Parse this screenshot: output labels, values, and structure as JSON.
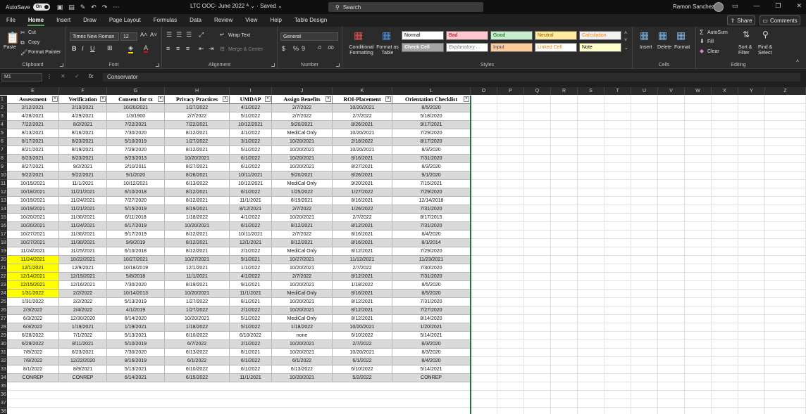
{
  "titlebar": {
    "autosave_label": "AutoSave",
    "autosave_state": "On",
    "doc_title": "LTC OOC- June 2022",
    "saved": "Saved",
    "search_placeholder": "Search",
    "user_name": "Ramon Sanchez"
  },
  "menu": [
    "File",
    "Home",
    "Insert",
    "Draw",
    "Page Layout",
    "Formulas",
    "Data",
    "Review",
    "View",
    "Help",
    "Table Design"
  ],
  "share_label": "Share",
  "comments_label": "Comments",
  "ribbon": {
    "clipboard": {
      "paste": "Paste",
      "cut": "Cut",
      "copy": "Copy",
      "format_painter": "Format Painter",
      "label": "Clipboard"
    },
    "font": {
      "name": "Times New Roman",
      "size": "12",
      "label": "Font"
    },
    "alignment": {
      "wrap": "Wrap Text",
      "merge": "Merge & Center",
      "label": "Alignment"
    },
    "number": {
      "format": "General",
      "label": "Number"
    },
    "styles": {
      "conditional": "Conditional Formatting",
      "format_table": "Format as Table",
      "cells": [
        {
          "text": "Normal",
          "bg": "#ffffff",
          "fg": "#000000"
        },
        {
          "text": "Bad",
          "bg": "#ffc7ce",
          "fg": "#9c0006"
        },
        {
          "text": "Good",
          "bg": "#c6efce",
          "fg": "#006100"
        },
        {
          "text": "Neutral",
          "bg": "#ffeb9c",
          "fg": "#9c5700"
        },
        {
          "text": "Calculation",
          "bg": "#f2f2f2",
          "fg": "#fa7d00"
        },
        {
          "text": "Check Cell",
          "bg": "#a5a5a5",
          "fg": "#ffffff"
        },
        {
          "text": "Explanatory ...",
          "bg": "#ffffff",
          "fg": "#7f7f7f"
        },
        {
          "text": "Input",
          "bg": "#ffcc99",
          "fg": "#3f3f76"
        },
        {
          "text": "Linked Cell",
          "bg": "#ffffff",
          "fg": "#fa7d00"
        },
        {
          "text": "Note",
          "bg": "#ffffcc",
          "fg": "#000000"
        }
      ],
      "label": "Styles"
    },
    "cells": {
      "insert": "Insert",
      "delete": "Delete",
      "format": "Format",
      "label": "Cells"
    },
    "editing": {
      "autosum": "AutoSum",
      "fill": "Fill",
      "clear": "Clear",
      "sort": "Sort & Filter",
      "find": "Find & Select",
      "label": "Editing"
    }
  },
  "formula_bar": {
    "name_box": "M1",
    "formula": "Conservator"
  },
  "columns": [
    "E",
    "F",
    "G",
    "H",
    "I",
    "J",
    "K",
    "L",
    "O",
    "P",
    "Q",
    "R",
    "S",
    "T",
    "U",
    "V",
    "W",
    "X",
    "Y",
    "Z"
  ],
  "headers": [
    "Assessment",
    "Verification",
    "Consent for tx",
    "Privacy Practices",
    "UMDAP",
    "Assign Benefits",
    "ROI-Placement",
    "Orientation Checklist"
  ],
  "rows": [
    [
      "2/12/2021",
      "2/19/2021",
      "10/20/2021",
      "1/27/2022",
      "4/1/2022",
      "2/7/2022",
      "10/20/2021",
      "8/5/2020"
    ],
    [
      "4/28/2021",
      "4/29/2021",
      "1/3/1900",
      "2/7/2022",
      "5/1/2022",
      "2/7/2022",
      "2/7/2022",
      "5/18/2020"
    ],
    [
      "7/22/2021",
      "8/2/2021",
      "7/22/2021",
      "7/22/2021",
      "10/12/2021",
      "9/20/2021",
      "8/26/2021",
      "9/17/2021"
    ],
    [
      "8/13/2021",
      "8/16/2021",
      "7/30/2020",
      "8/12/2021",
      "4/1/2022",
      "MediCal Only",
      "10/20/2021",
      "7/29/2020"
    ],
    [
      "8/17/2021",
      "8/23/2021",
      "5/10/2019",
      "1/27/2022",
      "3/1/2022",
      "10/20/2021",
      "2/18/2022",
      "8/17/2020"
    ],
    [
      "8/21/2021",
      "8/19/2021",
      "7/29/2020",
      "8/12/2021",
      "5/1/2022",
      "10/20/2021",
      "10/20/2021",
      "8/3/2020"
    ],
    [
      "8/23/2021",
      "8/23/2021",
      "8/23/2013",
      "10/20/2021",
      "6/1/2022",
      "10/20/2021",
      "8/16/2021",
      "7/31/2020"
    ],
    [
      "8/27/2021",
      "9/2/2021",
      "2/10/2011",
      "8/27/2021",
      "6/1/2022",
      "10/20/2021",
      "8/27/2021",
      "8/3/2020"
    ],
    [
      "9/22/2021",
      "9/22/2021",
      "9/1/2020",
      "8/26/2021",
      "10/11/2021",
      "9/20/2021",
      "8/26/2021",
      "9/1/2020"
    ],
    [
      "10/15/2021",
      "11/1/2021",
      "10/12/2021",
      "6/13/2022",
      "10/12/2021",
      "MediCal Only",
      "9/20/2021",
      "7/15/2021"
    ],
    [
      "10/18/2021",
      "11/21/2021",
      "6/10/2018",
      "8/12/2021",
      "6/1/2022",
      "1/25/2022",
      "1/27/2022",
      "7/29/2020"
    ],
    [
      "10/19/2021",
      "11/24/2021",
      "7/27/2020",
      "8/12/2021",
      "11/1/2021",
      "8/19/2021",
      "8/16/2021",
      "12/14/2018"
    ],
    [
      "10/19/2021",
      "11/21/2021",
      "5/15/2019",
      "8/19/2021",
      "8/12/2021",
      "2/7/2022",
      "1/26/2022",
      "7/31/2020"
    ],
    [
      "10/20/2021",
      "11/30/2021",
      "6/11/2018",
      "1/18/2022",
      "4/1/2022",
      "10/20/2021",
      "2/7/2022",
      "8/17/2015"
    ],
    [
      "10/20/2021",
      "11/24/2021",
      "6/17/2019",
      "10/20/2021",
      "6/1/2022",
      "8/12/2021",
      "8/12/2021",
      "7/31/2020"
    ],
    [
      "10/27/2021",
      "11/30/2021",
      "9/17/2019",
      "8/12/2021",
      "10/11/2021",
      "2/7/2022",
      "8/16/2021",
      "8/4/2020"
    ],
    [
      "10/27/2021",
      "11/30/2021",
      "9/9/2019",
      "8/12/2021",
      "12/1/2021",
      "8/12/2021",
      "8/16/2021",
      "8/1/2014"
    ],
    [
      "11/24/2021",
      "11/25/2021",
      "6/10/2018",
      "8/12/2021",
      "2/1/2022",
      "MediCal Only",
      "8/12/2021",
      "7/29/2020"
    ],
    [
      "11/24/2021",
      "10/22/2021",
      "10/27/2021",
      "10/27/2021",
      "9/1/2021",
      "10/27/2021",
      "11/12/2021",
      "11/23/2021"
    ],
    [
      "12/1/2021",
      "12/9/2021",
      "10/18/2019",
      "12/1/2021",
      "1/1/2022",
      "10/20/2021",
      "2/7/2022",
      "7/30/2020"
    ],
    [
      "12/14/2021",
      "12/15/2021",
      "5/8/2018",
      "11/1/2021",
      "4/1/2022",
      "2/7/2022",
      "8/12/2021",
      "7/31/2020"
    ],
    [
      "12/15/2021",
      "12/16/2021",
      "7/30/2020",
      "8/19/2021",
      "9/1/2021",
      "10/20/2021",
      "1/18/2022",
      "8/5/2020"
    ],
    [
      "1/31/2022",
      "2/2/2022",
      "10/14/2013",
      "10/20/2021",
      "11/1/2021",
      "MediCal Only",
      "8/16/2021",
      "8/5/2020"
    ],
    [
      "1/31/2022",
      "2/2/2022",
      "5/13/2019",
      "1/27/2022",
      "8/1/2021",
      "10/20/2021",
      "8/12/2021",
      "7/31/2020"
    ],
    [
      "2/3/2022",
      "2/4/2022",
      "4/1/2019",
      "1/27/2022",
      "2/1/2022",
      "10/20/2021",
      "8/12/2021",
      "7/27/2020"
    ],
    [
      "6/3/2022",
      "12/30/2020",
      "8/14/2020",
      "10/20/2021",
      "5/1/2022",
      "MediCal Only",
      "8/12/2021",
      "8/14/2020"
    ],
    [
      "6/3/2022",
      "1/19/2021",
      "1/19/2021",
      "1/18/2022",
      "5/1/2022",
      "1/18/2022",
      "10/20/2021",
      "1/20/2021"
    ],
    [
      "6/28/2022",
      "7/1/2022",
      "5/13/2021",
      "6/10/2022",
      "6/10/2022",
      "none",
      "6/10/2022",
      "5/14/2021"
    ],
    [
      "6/29/2022",
      "8/11/2021",
      "5/10/2019",
      "6/7/2022",
      "2/1/2022",
      "10/20/2021",
      "2/7/2022",
      "8/3/2020"
    ],
    [
      "7/8/2022",
      "6/23/2021",
      "7/30/2020",
      "6/13/2022",
      "8/1/2021",
      "10/20/2021",
      "10/20/2021",
      "8/3/2020"
    ],
    [
      "7/8/2022",
      "12/22/2020",
      "8/16/2019",
      "6/1/2022",
      "6/1/2022",
      "6/1/2022",
      "6/1/2022",
      "8/4/2020"
    ],
    [
      "8/1/2022",
      "8/9/2021",
      "5/13/2021",
      "6/10/2022",
      "6/1/2022",
      "6/13/2022",
      "6/10/2022",
      "5/14/2021"
    ],
    [
      "CONREP",
      "CONREP",
      "6/14/2021",
      "6/15/2022",
      "11/1/2021",
      "10/20/2021",
      "5/2/2022",
      "CONREP"
    ]
  ],
  "highlighted_rows": [
    18,
    19,
    20,
    21,
    22
  ],
  "row_numbers": [
    "1",
    "2",
    "3",
    "4",
    "5",
    "6",
    "7",
    "8",
    "9",
    "10",
    "11",
    "12",
    "13",
    "14",
    "15",
    "16",
    "17",
    "18",
    "19",
    "20",
    "21",
    "22",
    "23",
    "24",
    "25",
    "26",
    "27",
    "28",
    "29",
    "30",
    "31",
    "32",
    "33",
    "34",
    "35",
    "36",
    "37",
    "38"
  ]
}
